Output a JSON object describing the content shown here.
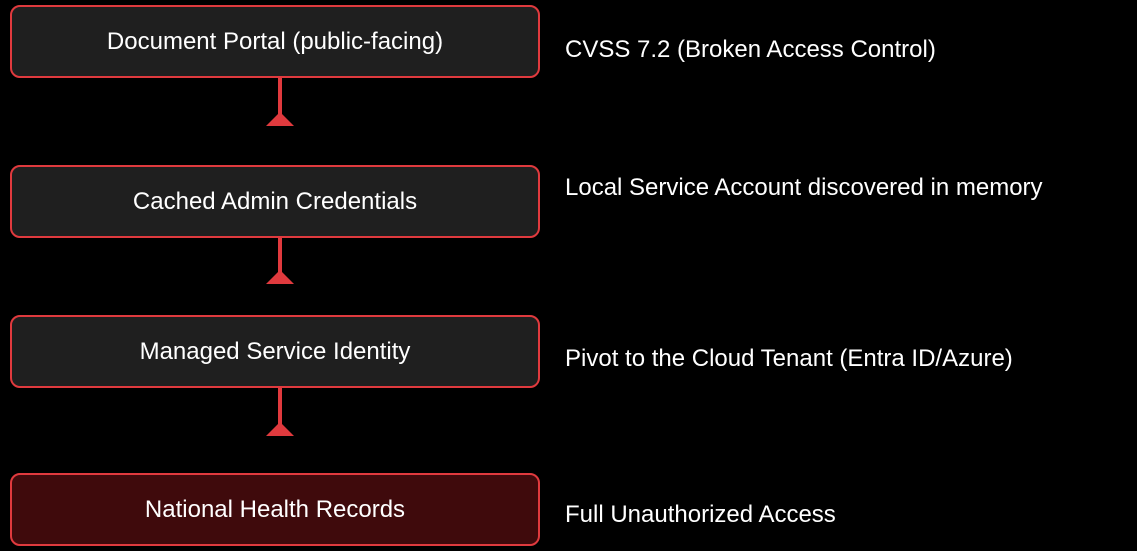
{
  "colors": {
    "background": "#000000",
    "accent_red": "#e03a3e",
    "node_fill": "#1f1f1f",
    "target_fill": "#3f0a0c",
    "text": "#ffffff"
  },
  "chain": [
    {
      "label": "Document Portal (public-facing)",
      "note": "CVSS 7.2 (Broken Access Control)"
    },
    {
      "label": "Cached Admin Credentials",
      "note": "Local Service Account discovered in memory"
    },
    {
      "label": "Managed Service Identity",
      "note": "Pivot to the Cloud Tenant (Entra ID/Azure)"
    },
    {
      "label": "National Health Records",
      "note": "Full Unauthorized Access"
    }
  ]
}
